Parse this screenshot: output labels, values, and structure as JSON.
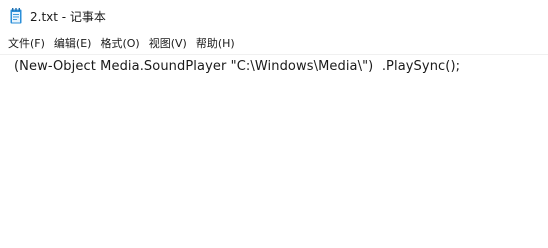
{
  "window": {
    "title": "2.txt - 记事本",
    "icon": "notepad-icon"
  },
  "menu": {
    "items": [
      {
        "label": "文件(F)"
      },
      {
        "label": "编辑(E)"
      },
      {
        "label": "格式(O)"
      },
      {
        "label": "视图(V)"
      },
      {
        "label": "帮助(H)"
      }
    ]
  },
  "editor": {
    "content": "(New-Object Media.SoundPlayer \"C:\\Windows\\Media\\\")  .PlaySync();"
  },
  "colors": {
    "icon_blue": "#2b8fd9",
    "text": "#1a1a1a"
  }
}
